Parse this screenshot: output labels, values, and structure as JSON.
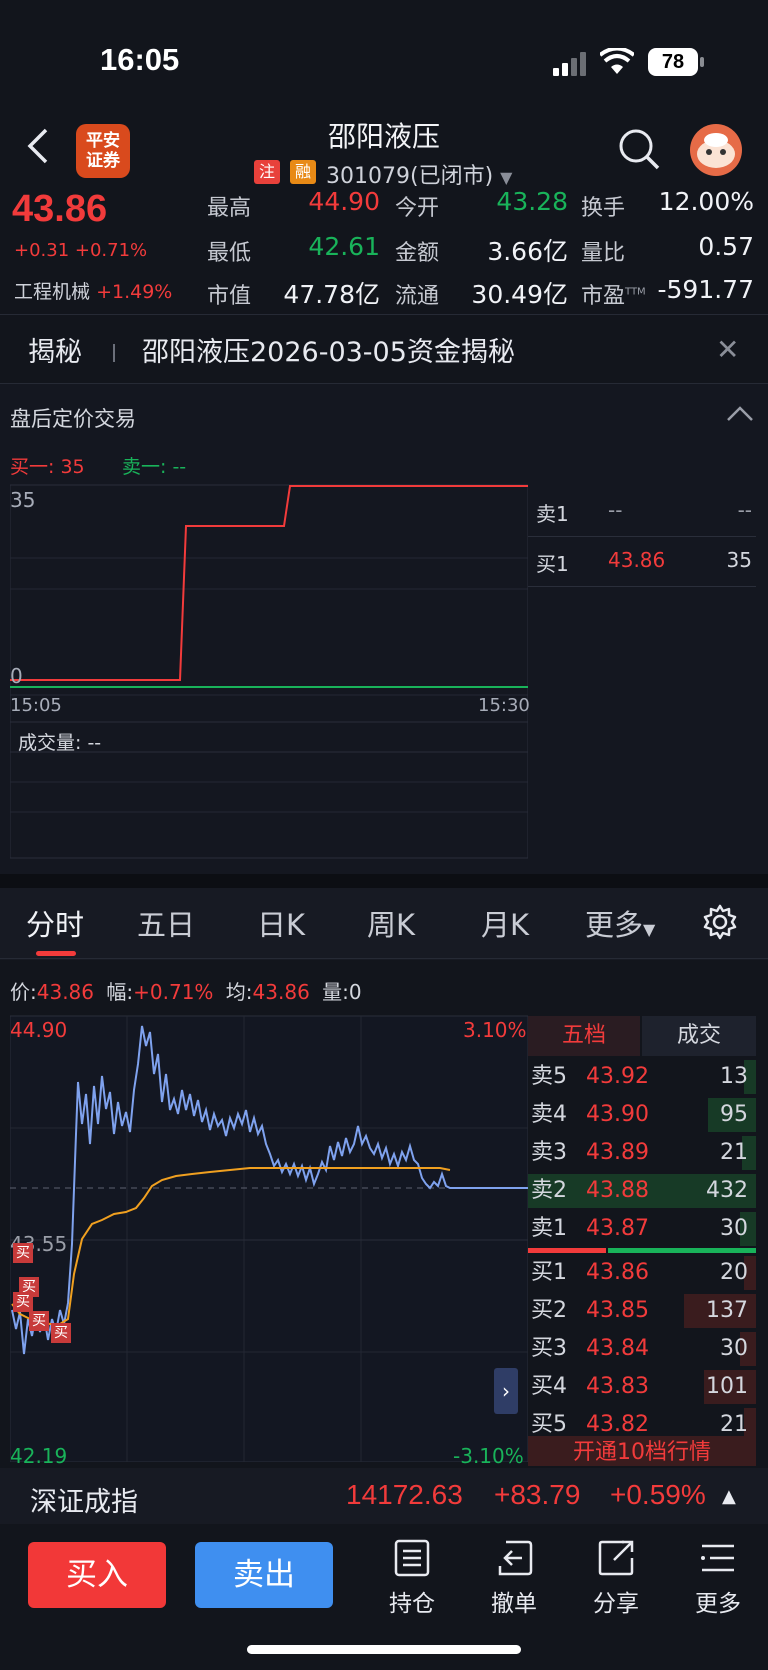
{
  "status": {
    "time": "16:05",
    "battery": "78"
  },
  "header": {
    "title": "邵阳液压",
    "tag1": "注",
    "tag2": "融",
    "code": "301079(已闭市)",
    "logo_line1": "平安",
    "logo_line2": "证券"
  },
  "quote": {
    "price": "43.86",
    "change": "+0.31 +0.71%",
    "industry_name": "工程机械",
    "industry_change": "+1.49%",
    "high_label": "最高",
    "high": "44.90",
    "open_label": "今开",
    "open": "43.28",
    "turnover_label": "换手",
    "turnover": "12.00%",
    "low_label": "最低",
    "low": "42.61",
    "amount_label": "金额",
    "amount": "3.66亿",
    "vol_ratio_label": "量比",
    "vol_ratio": "0.57",
    "mktcap_label": "市值",
    "mktcap": "47.78亿",
    "float_label": "流通",
    "float": "30.49亿",
    "pe_label": "市盈",
    "pe_sup": "TTM",
    "pe": "-591.77"
  },
  "banner": {
    "title": "揭秘",
    "text": "邵阳液压2026-03-05资金揭秘"
  },
  "after_hours": {
    "title": "盘后定价交易",
    "buy1_label": "买一: 35",
    "sell1_label": "卖一: --",
    "y_top": "35",
    "y_bottom": "0",
    "x_start": "15:05",
    "x_end": "15:30",
    "volume_label": "成交量: --",
    "book": [
      {
        "label": "卖1",
        "price": "--",
        "qty": "--"
      },
      {
        "label": "买1",
        "price": "43.86",
        "qty": "35"
      }
    ]
  },
  "tabs": [
    "分时",
    "五日",
    "日K",
    "周K",
    "月K",
    "更多"
  ],
  "infoline": {
    "price_label": "价:",
    "price": "43.86",
    "range_label": "幅:",
    "range": "+0.71%",
    "avg_label": "均:",
    "avg": "43.86",
    "vol_label": "量:",
    "vol": "0"
  },
  "intraday": {
    "y_top": "44.90",
    "y_mid": "43.55",
    "y_bottom": "42.19",
    "pct_top": "3.10%",
    "pct_bottom": "-3.10%",
    "marker_label": "买"
  },
  "orderbook": {
    "tab_active": "五档",
    "tab_other": "成交",
    "rows": [
      {
        "label": "卖5",
        "price": "43.92",
        "qty": "13"
      },
      {
        "label": "卖4",
        "price": "43.90",
        "qty": "95"
      },
      {
        "label": "卖3",
        "price": "43.89",
        "qty": "21"
      },
      {
        "label": "卖2",
        "price": "43.88",
        "qty": "432"
      },
      {
        "label": "卖1",
        "price": "43.87",
        "qty": "30"
      },
      {
        "label": "买1",
        "price": "43.86",
        "qty": "20"
      },
      {
        "label": "买2",
        "price": "43.85",
        "qty": "137"
      },
      {
        "label": "买3",
        "price": "43.84",
        "qty": "30"
      },
      {
        "label": "买4",
        "price": "43.83",
        "qty": "101"
      },
      {
        "label": "买5",
        "price": "43.82",
        "qty": "21"
      }
    ],
    "open10": "开通10档行情"
  },
  "index": {
    "name": "深证成指",
    "value": "14172.63",
    "change": "+83.79",
    "pct": "+0.59%"
  },
  "bottom": {
    "buy": "买入",
    "sell": "卖出",
    "hold": "持仓",
    "cancel": "撤单",
    "share": "分享",
    "more": "更多"
  },
  "colors": {
    "up": "#f23b3b",
    "down": "#19b35a",
    "price_line": "#7fa2ee",
    "avg_line": "#f0a020"
  }
}
